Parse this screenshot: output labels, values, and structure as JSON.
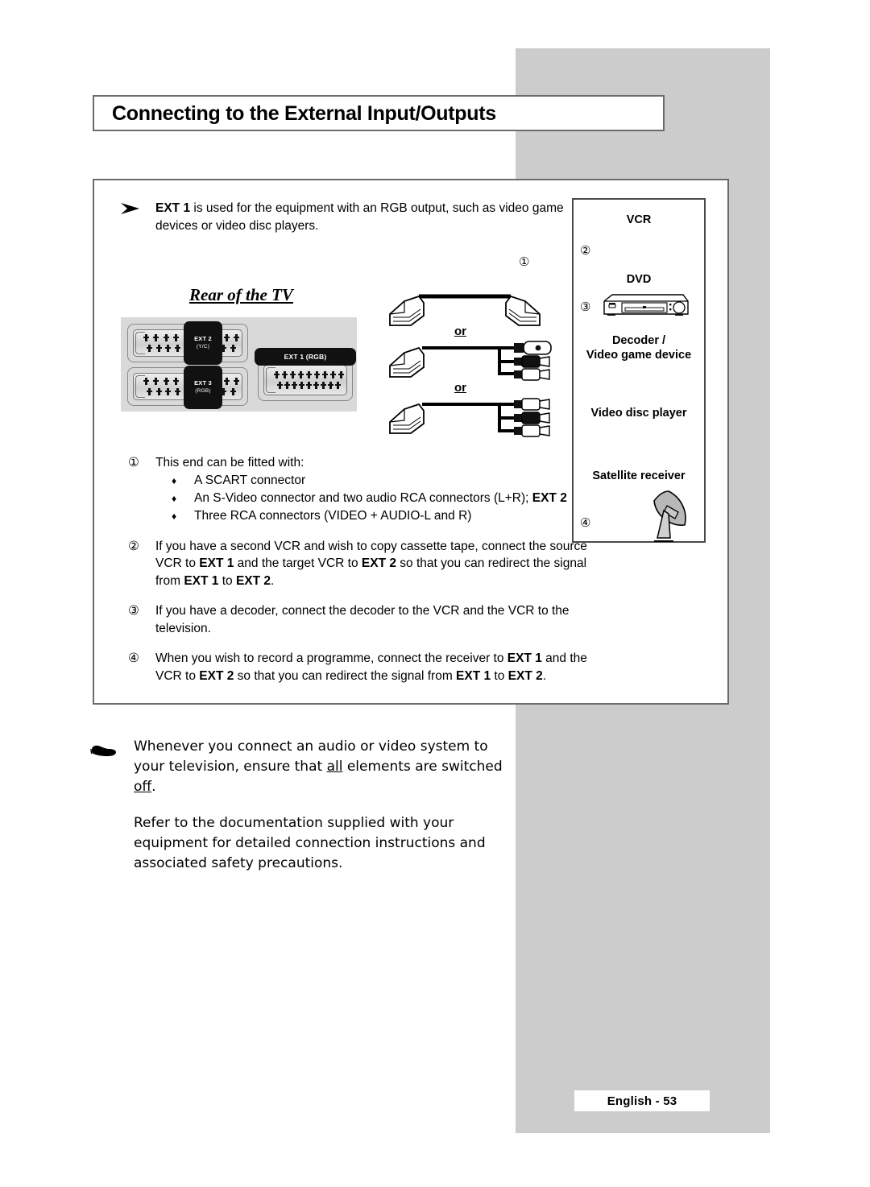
{
  "page": {
    "title": "Connecting to the External Input/Outputs",
    "footer_label": "English - 53",
    "colors": {
      "gray_panel": "#cccccc",
      "border": "#6b6b6b",
      "scart_panel_bg": "#d9d9d9",
      "tab_black": "#111111"
    }
  },
  "intro": {
    "bullet_icon": "arrow-bullet-icon",
    "bold_lead": "EXT 1",
    "rest": " is used for the equipment with an RGB output, such as video game devices or video disc players."
  },
  "diagram": {
    "rear_label": "Rear of the TV",
    "sockets": [
      {
        "name": "EXT 2",
        "sub": "(Y/C)"
      },
      {
        "name": "EXT 3",
        "sub": "(RGB)"
      },
      {
        "name": "EXT 1 (RGB)",
        "sub": ""
      }
    ],
    "cable_options": {
      "or_1": "or",
      "or_2": "or"
    },
    "callout_1": "①"
  },
  "notes": [
    {
      "num": "①",
      "text": "This end can be fitted with:",
      "bullets": [
        {
          "marker": "♦",
          "text": "A SCART connector"
        },
        {
          "marker": "♦",
          "text": "An S-Video connector and two audio RCA connectors (L+R); ",
          "bold_tail": "EXT 2"
        },
        {
          "marker": "♦",
          "text": "Three RCA connectors (VIDEO + AUDIO-L and R)"
        }
      ]
    },
    {
      "num": "②",
      "text": "If you have a second VCR and wish to copy cassette tape, connect the source VCR to EXT 1 and the target VCR to EXT 2 so that you can redirect the signal from EXT 1 to EXT 2."
    },
    {
      "num": "③",
      "text": "If you have a decoder, connect the decoder to the VCR and the VCR to the television."
    },
    {
      "num": "④",
      "text": "When you wish to record a programme, connect the receiver to EXT 1 and the VCR to EXT 2 so that you can redirect the signal from EXT 1 to EXT 2."
    }
  ],
  "info_box": {
    "items": [
      {
        "label": "VCR",
        "num": "②"
      },
      {
        "label": "DVD",
        "num": "③",
        "icon": "dvd-player-icon"
      },
      {
        "label": "Decoder /",
        "label2": "Video game device"
      },
      {
        "label": "Video disc player"
      },
      {
        "label": "Satellite receiver",
        "num": "④",
        "icon": "satellite-dish-icon"
      }
    ]
  },
  "bottom_note": {
    "icon": "pointing-hand-icon",
    "para1_a": "Whenever you connect an audio or video system to your television, ensure that ",
    "para1_u1": "all",
    "para1_b": " elements are switched ",
    "para1_u2": "off",
    "para1_c": ".",
    "para2": "Refer to the documentation supplied with your equipment for detailed connection instructions and associated safety precautions."
  }
}
